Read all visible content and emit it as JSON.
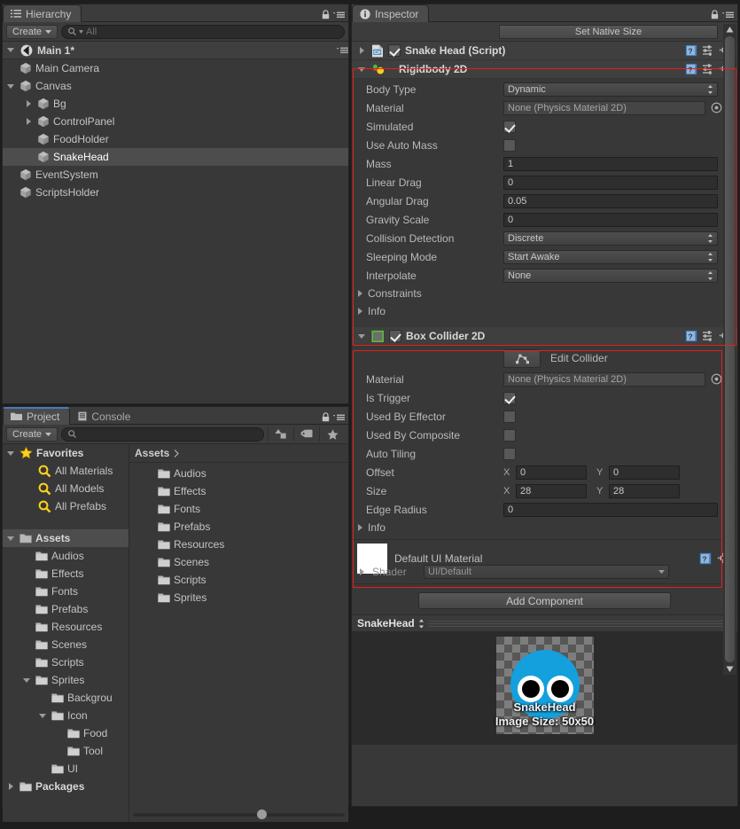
{
  "hierarchy": {
    "tab_label": "Hierarchy",
    "create_label": "Create",
    "search_placeholder": "All",
    "scene_name": "Main 1*",
    "items": [
      {
        "label": "Main Camera",
        "depth": 1,
        "arrow": "none"
      },
      {
        "label": "Canvas",
        "depth": 1,
        "arrow": "open"
      },
      {
        "label": "Bg",
        "depth": 2,
        "arrow": "closed"
      },
      {
        "label": "ControlPanel",
        "depth": 2,
        "arrow": "closed"
      },
      {
        "label": "FoodHolder",
        "depth": 2,
        "arrow": "none"
      },
      {
        "label": "SnakeHead",
        "depth": 2,
        "arrow": "none",
        "selected": true
      },
      {
        "label": "EventSystem",
        "depth": 1,
        "arrow": "none"
      },
      {
        "label": "ScriptsHolder",
        "depth": 1,
        "arrow": "none"
      }
    ]
  },
  "project": {
    "tab_label": "Project",
    "console_tab_label": "Console",
    "create_label": "Create",
    "search_placeholder": "",
    "breadcrumb": "Assets",
    "favorites_label": "Favorites",
    "favorites": [
      "All Materials",
      "All Models",
      "All Prefabs"
    ],
    "assets_label": "Assets",
    "tree": [
      {
        "label": "Audios",
        "depth": 1,
        "arrow": "none"
      },
      {
        "label": "Effects",
        "depth": 1,
        "arrow": "none"
      },
      {
        "label": "Fonts",
        "depth": 1,
        "arrow": "none"
      },
      {
        "label": "Prefabs",
        "depth": 1,
        "arrow": "none"
      },
      {
        "label": "Resources",
        "depth": 1,
        "arrow": "none"
      },
      {
        "label": "Scenes",
        "depth": 1,
        "arrow": "none"
      },
      {
        "label": "Scripts",
        "depth": 1,
        "arrow": "none"
      },
      {
        "label": "Sprites",
        "depth": 1,
        "arrow": "open"
      },
      {
        "label": "Backgrou",
        "depth": 2,
        "arrow": "none"
      },
      {
        "label": "Icon",
        "depth": 2,
        "arrow": "open"
      },
      {
        "label": "Food",
        "depth": 3,
        "arrow": "none"
      },
      {
        "label": "Tool",
        "depth": 3,
        "arrow": "none"
      },
      {
        "label": "UI",
        "depth": 2,
        "arrow": "none"
      },
      {
        "label": "Packages",
        "depth": 0,
        "arrow": "closed",
        "bold": true
      }
    ],
    "contents": [
      "Audios",
      "Effects",
      "Fonts",
      "Prefabs",
      "Resources",
      "Scenes",
      "Scripts",
      "Sprites"
    ]
  },
  "inspector": {
    "tab_label": "Inspector",
    "set_native_size": "Set Native Size",
    "script_component": "Snake Head (Script)",
    "rigidbody": {
      "title": "Rigidbody 2D",
      "body_type_label": "Body Type",
      "body_type_value": "Dynamic",
      "material_label": "Material",
      "material_value": "None (Physics Material 2D)",
      "simulated_label": "Simulated",
      "use_auto_mass_label": "Use Auto Mass",
      "mass_label": "Mass",
      "mass_value": "1",
      "linear_drag_label": "Linear Drag",
      "linear_drag_value": "0",
      "angular_drag_label": "Angular Drag",
      "angular_drag_value": "0.05",
      "gravity_scale_label": "Gravity Scale",
      "gravity_scale_value": "0",
      "collision_detection_label": "Collision Detection",
      "collision_detection_value": "Discrete",
      "sleeping_mode_label": "Sleeping Mode",
      "sleeping_mode_value": "Start Awake",
      "interpolate_label": "Interpolate",
      "interpolate_value": "None",
      "constraints_label": "Constraints",
      "info_label": "Info"
    },
    "collider": {
      "title": "Box Collider 2D",
      "edit_collider_label": "Edit Collider",
      "material_label": "Material",
      "material_value": "None (Physics Material 2D)",
      "is_trigger_label": "Is Trigger",
      "used_by_effector_label": "Used By Effector",
      "used_by_composite_label": "Used By Composite",
      "auto_tiling_label": "Auto Tiling",
      "offset_label": "Offset",
      "offset_x": "0",
      "offset_y": "0",
      "size_label": "Size",
      "size_x": "28",
      "size_y": "28",
      "edge_radius_label": "Edge Radius",
      "edge_radius_value": "0",
      "info_label": "Info",
      "axis_x": "X",
      "axis_y": "Y"
    },
    "material": {
      "name": "Default UI Material",
      "shader_label": "Shader",
      "shader_value": "UI/Default"
    },
    "add_component": "Add Component",
    "preview": {
      "title": "SnakeHead",
      "sprite_name": "SnakeHead",
      "image_size": "Image Size: 50x50"
    }
  },
  "colors": {
    "accent_tab": "#4a7ab5",
    "annotation_red": "#ee1c1c",
    "sprite_blue": "#149fdd",
    "favorite_yellow": "#ffd11a"
  }
}
